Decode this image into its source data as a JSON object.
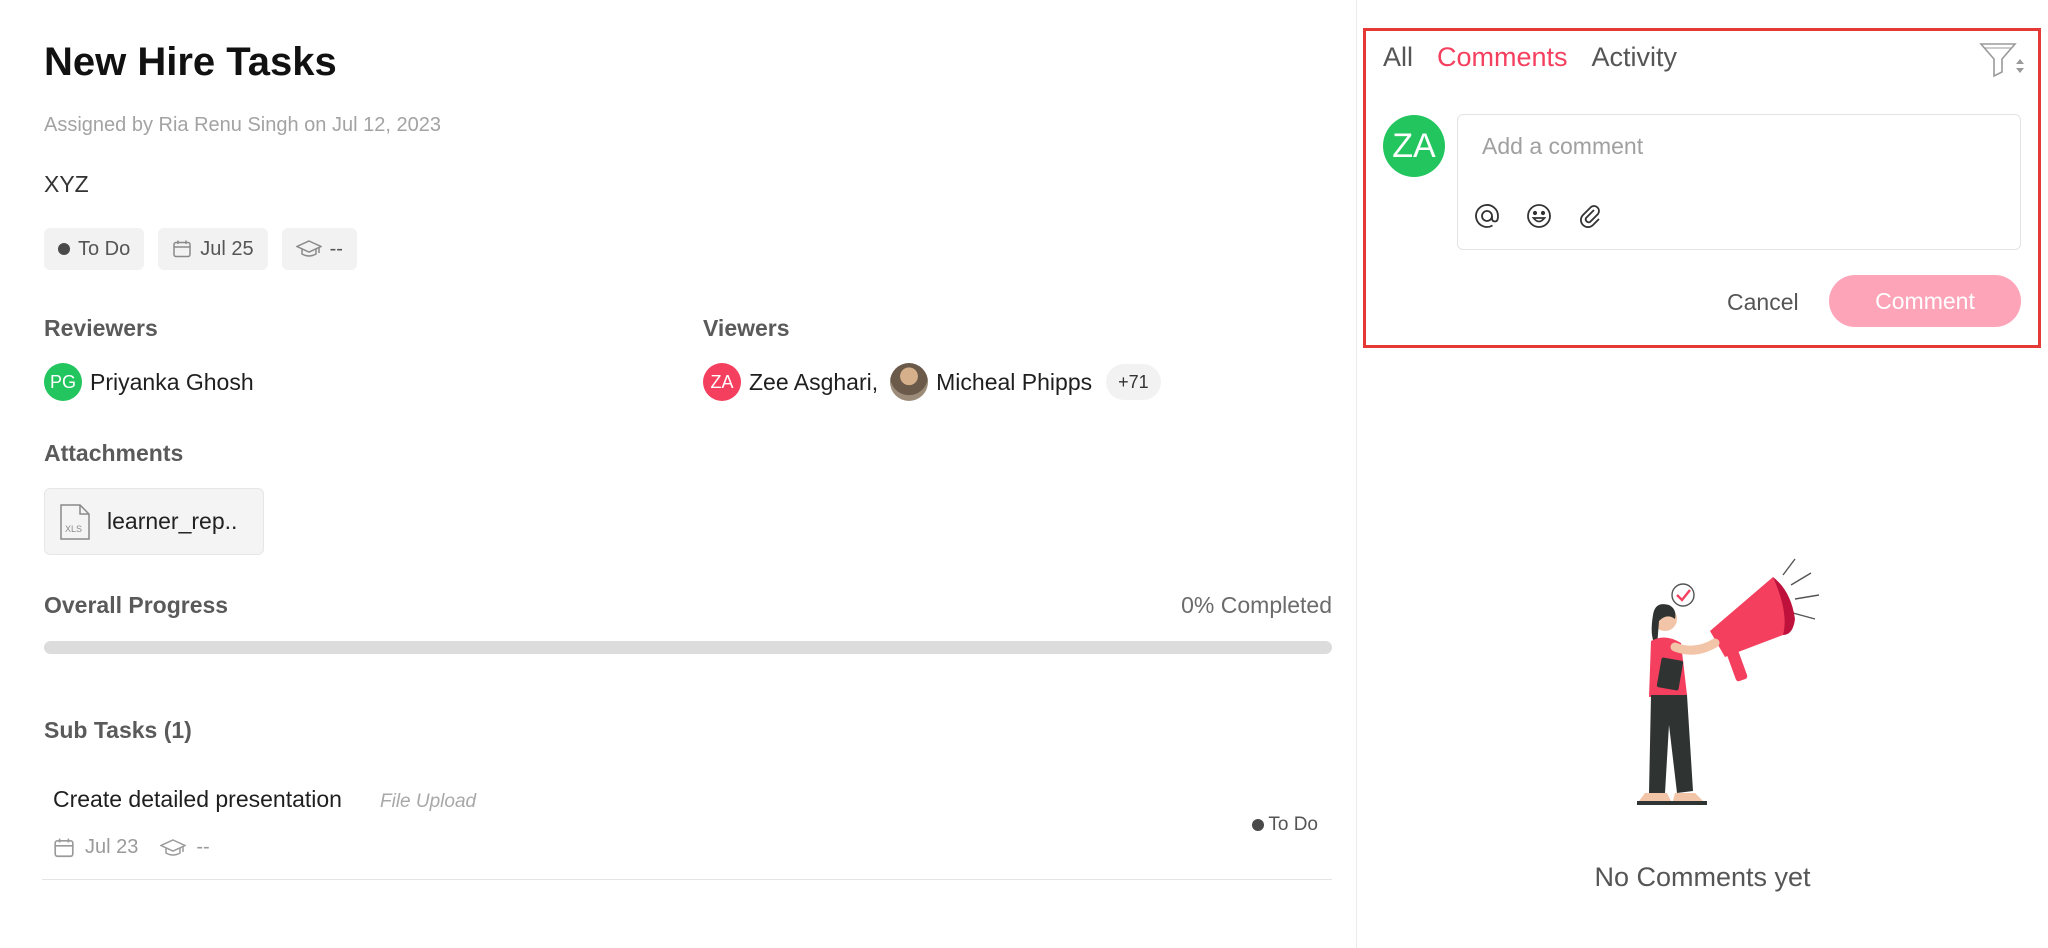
{
  "task": {
    "title": "New Hire Tasks",
    "assigned_prefix": "Assigned by Ria Renu Singh on",
    "assigned_date": "Jul 12, 2023",
    "description": "XYZ",
    "chips": {
      "status": "To Do",
      "due_date": "Jul 25",
      "course": "--"
    }
  },
  "reviewers": {
    "label": "Reviewers",
    "items": [
      {
        "initials": "PG",
        "name": "Priyanka Ghosh"
      }
    ]
  },
  "viewers": {
    "label": "Viewers",
    "items": [
      {
        "initials": "ZA",
        "name": "Zee Asghari,"
      },
      {
        "initials": "",
        "name": "Micheal Phipps"
      }
    ],
    "more": "+71"
  },
  "attachments": {
    "label": "Attachments",
    "files": [
      {
        "ext": "XLS",
        "name": "learner_rep.."
      }
    ]
  },
  "progress": {
    "label": "Overall Progress",
    "text": "0% Completed",
    "value": 0
  },
  "subtasks": {
    "label": "Sub Tasks (1)",
    "items": [
      {
        "title": "Create detailed presentation",
        "type": "File Upload",
        "date": "Jul 23",
        "course": "--",
        "status": "To Do"
      }
    ]
  },
  "comments_panel": {
    "tabs": [
      "All",
      "Comments",
      "Activity"
    ],
    "active_tab": "Comments",
    "user_initials": "ZA",
    "placeholder": "Add a comment",
    "cancel_label": "Cancel",
    "submit_label": "Comment",
    "empty_text": "No Comments yet"
  },
  "colors": {
    "accent": "#f43f5e",
    "accent_light": "#fda4b8",
    "avatar_green": "#22c55e",
    "highlight_border": "#e53935"
  }
}
